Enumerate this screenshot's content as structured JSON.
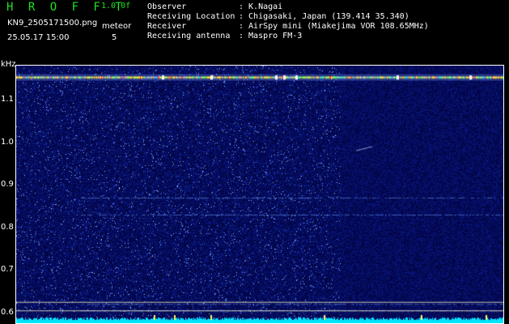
{
  "header": {
    "app_title": "H R O F F T",
    "version": "1.0.0f",
    "filename": "KN9_2505171500.png",
    "meteor_label": "meteor",
    "datetime": "25.05.17 15:00",
    "meteor_count": "5",
    "info_labels": [
      "Observer",
      "Receiving Location",
      "Receiver",
      "Receiving antenna"
    ],
    "info_values": [
      ": K.Nagai",
      ": Chigasaki, Japan (139.414 35.340)",
      ": AirSpy mini (Miakejima VOR 108.65MHz)",
      ": Maspro FM-3"
    ]
  },
  "colors": {
    "header_text": "#22e022",
    "info_text": "#ffffff",
    "background": "#020444",
    "noise": "#3a7fff",
    "baseline": "#00e5ff",
    "strong_line": "#ff5050"
  },
  "chart_data": {
    "type": "heatmap",
    "xlabel": "",
    "ylabel": "kHz",
    "x_ticks": [
      "1501",
      "1502",
      "1503",
      "1504",
      "1505",
      "1506",
      "1507",
      "1508",
      "1509",
      "1510"
    ],
    "x_range": [
      1500.6,
      1510.3
    ],
    "y_ticks": [
      "1.1",
      "1.0",
      "0.9",
      "0.8",
      "0.7",
      "0.6"
    ],
    "y_range": [
      0.575,
      1.18
    ],
    "features": {
      "carrier_khz": 1.153,
      "faint_lines_khz": [
        0.83,
        0.87,
        0.62,
        0.605
      ],
      "white_lines_khz": [
        0.625,
        0.605
      ]
    }
  }
}
